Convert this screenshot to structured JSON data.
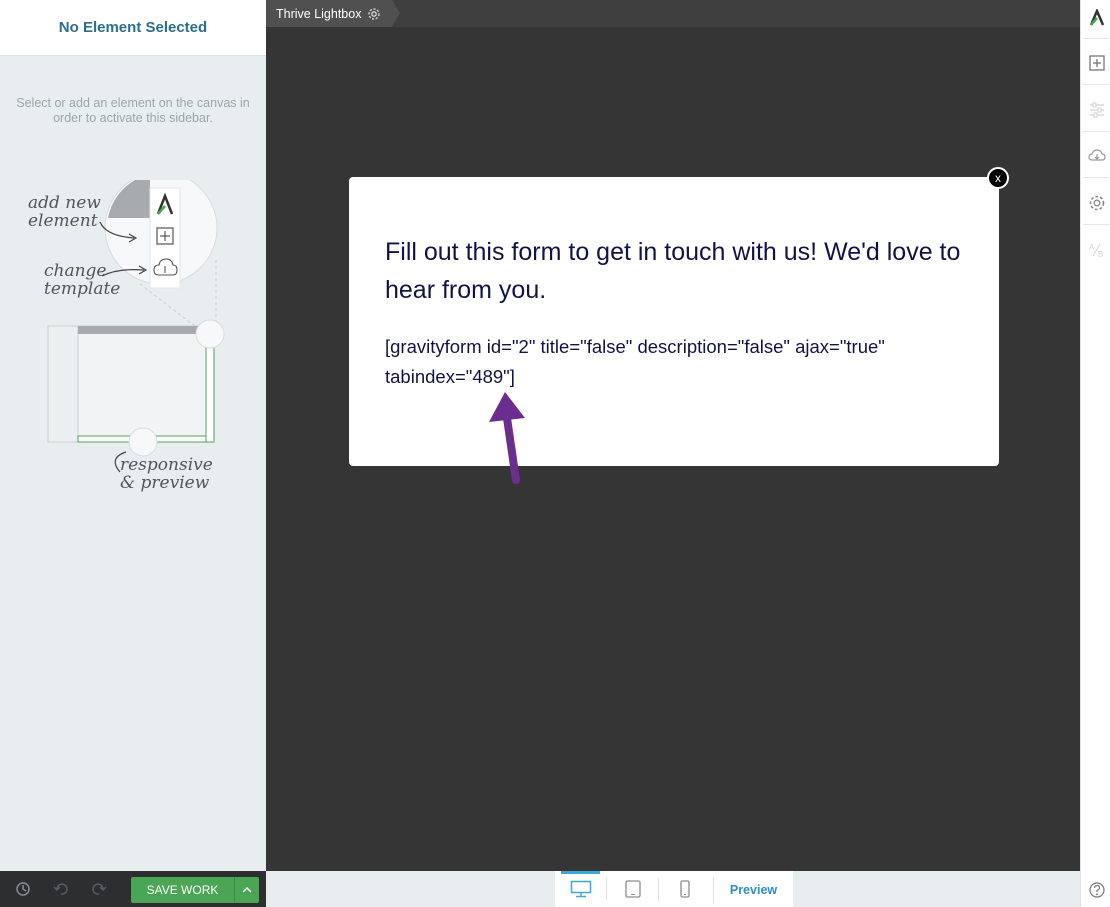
{
  "sidebar": {
    "title": "No Element Selected",
    "hint": "Select or add an element on the canvas in order to activate this sidebar.",
    "illustration": {
      "add_new_element": "add new element",
      "change_template": "change template",
      "responsive_preview": "responsive & preview"
    }
  },
  "topbar": {
    "tab_title": "Thrive Lightbox",
    "tab_icon": "gear-icon"
  },
  "lightbox": {
    "heading": "Fill out this form to get in touch with us! We'd love to hear from you.",
    "shortcode": "[gravityform id=\"2\" title=\"false\" description=\"false\" ajax=\"true\" tabindex=\"489\"]",
    "close_label": "x"
  },
  "bottom_left": {
    "save_label": "SAVE WORK",
    "icons": [
      "history-icon",
      "undo-icon",
      "redo-icon"
    ]
  },
  "device_bar": {
    "devices": [
      "desktop-icon",
      "tablet-icon",
      "mobile-icon"
    ],
    "active_device": "desktop",
    "preview_label": "Preview"
  },
  "right_toolbar": {
    "icons": [
      "thrive-logo-icon",
      "add-element-icon",
      "settings-sliders-icon",
      "cloud-download-icon",
      "gear-icon",
      "ab-test-icon",
      "help-icon"
    ]
  },
  "colors": {
    "accent_blue": "#2b6e8f",
    "save_green": "#4aa655",
    "canvas": "#353535",
    "heading_navy": "#12124a",
    "arrow_purple": "#6b2d8f"
  }
}
